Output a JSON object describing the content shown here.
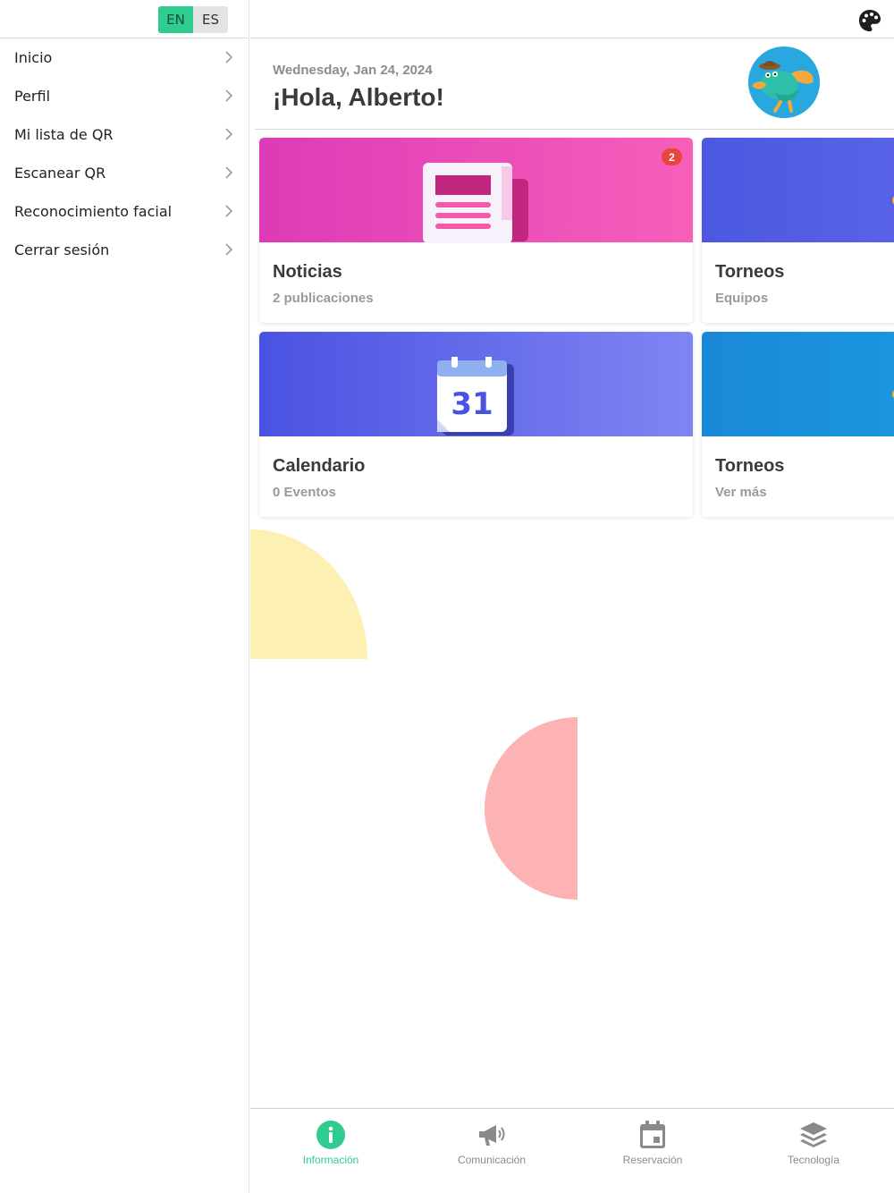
{
  "sidebar": {
    "languages": [
      {
        "code": "EN",
        "active": true
      },
      {
        "code": "ES",
        "active": false
      }
    ],
    "menu": [
      {
        "label": "Inicio"
      },
      {
        "label": "Perfil"
      },
      {
        "label": "Mi lista de QR"
      },
      {
        "label": "Escanear QR"
      },
      {
        "label": "Reconocimiento facial"
      },
      {
        "label": "Cerrar sesión"
      }
    ]
  },
  "header": {
    "date": "Wednesday, Jan 24, 2024",
    "greeting": "¡Hola, Alberto!",
    "icons": {
      "theme": "palette-icon",
      "avatar": "platypus-avatar"
    }
  },
  "cards": [
    {
      "title": "Noticias",
      "subtitle": "2 publicaciones",
      "badge": "2",
      "icon": "newspaper-icon",
      "colors": [
        "#dd3bb6",
        "#f75fba"
      ]
    },
    {
      "title": "Torneos",
      "subtitle": "Equipos",
      "icon": "trophy-icon",
      "colors": [
        "#4c58e0",
        "#6a70ef"
      ]
    },
    {
      "title": "Calendario",
      "subtitle": "0 Eventos",
      "icon": "calendar-icon",
      "calendar_day": "31",
      "colors": [
        "#4a52e2",
        "#7f85f2"
      ]
    },
    {
      "title": "Torneos",
      "subtitle": "Ver más",
      "icon": "trophy-icon",
      "colors": [
        "#1a88d8",
        "#1ca6e4"
      ]
    }
  ],
  "bottom_nav": [
    {
      "label": "Información",
      "icon": "info-icon",
      "active": true
    },
    {
      "label": "Comunicación",
      "icon": "megaphone-icon",
      "active": false
    },
    {
      "label": "Reservación",
      "icon": "calendar-icon",
      "active": false
    },
    {
      "label": "Tecnología",
      "icon": "layers-icon",
      "active": false
    }
  ],
  "colors": {
    "accent": "#2ecc8f",
    "badge": "#e8453c",
    "deco_yellow": "#fdf0b3",
    "deco_pink": "#fdb3b3"
  }
}
